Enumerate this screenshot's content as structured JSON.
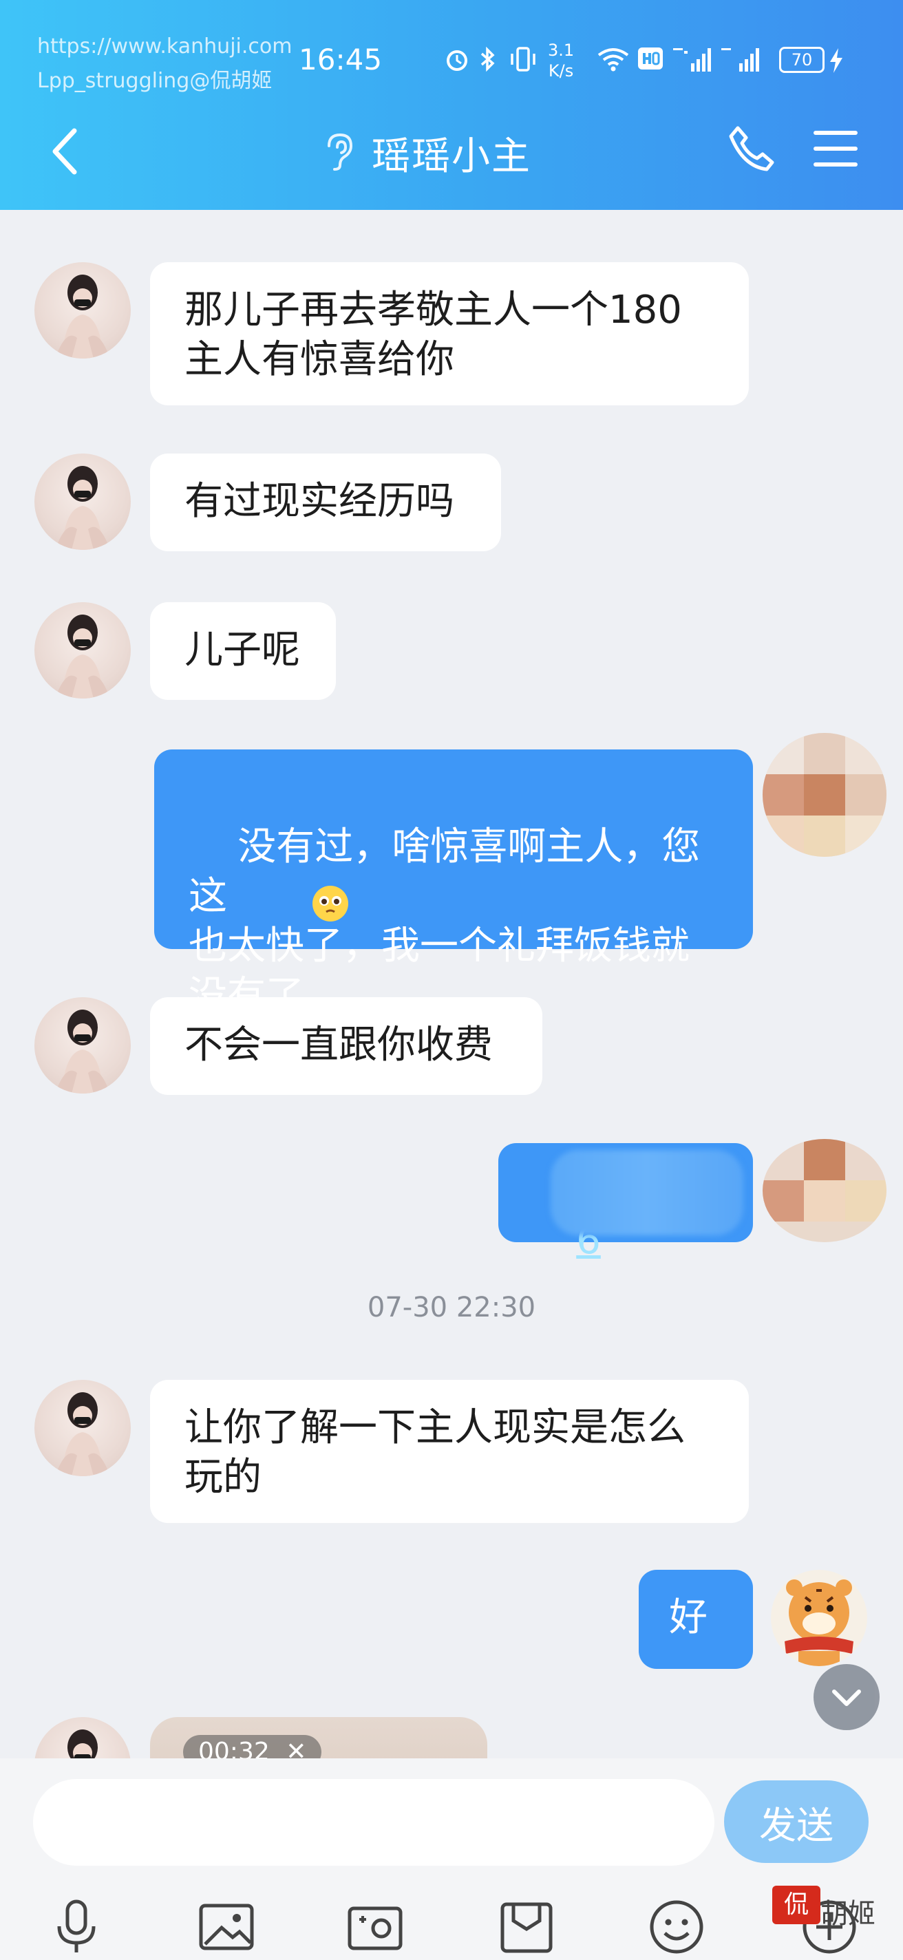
{
  "watermark": {
    "url": "https://www.kanhuji.com",
    "user": "Lpp_struggling@侃胡姬"
  },
  "status_bar": {
    "time": "16:45",
    "net_speed_value": "3.1",
    "net_speed_unit": "K/s",
    "battery": "70"
  },
  "header": {
    "title": "瑶瑶小主"
  },
  "messages": [
    {
      "side": "in",
      "text": "那儿子再去孝敬主人一个180\n主人有惊喜给你"
    },
    {
      "side": "in",
      "text": "有过现实经历吗"
    },
    {
      "side": "in",
      "text": "儿子呢"
    },
    {
      "side": "out",
      "text": "没有过，啥惊喜啊主人，您这\n也太快了，我一个礼拜饭钱就\n没有了"
    },
    {
      "side": "in",
      "text": "不会一直跟你收费"
    },
    {
      "side": "out",
      "text": "6"
    },
    {
      "side": "in",
      "text": "让你了解一下主人现实是怎么\n玩的"
    },
    {
      "side": "out",
      "text": "好"
    }
  ],
  "timestamp": "07-30 22:30",
  "video": {
    "duration": "00:32"
  },
  "composer": {
    "input_value": "",
    "send_label": "发送"
  },
  "toolbar": [
    "microphone-icon",
    "image-icon",
    "camera-icon",
    "folder-icon",
    "emoji-icon",
    "plus-icon"
  ],
  "logo": {
    "stamp": "侃",
    "text": "胡姬"
  },
  "colors": {
    "header": "#3aa6f2",
    "outgoing_bubble": "#3e97f7",
    "send_button": "#8cc8f7"
  }
}
